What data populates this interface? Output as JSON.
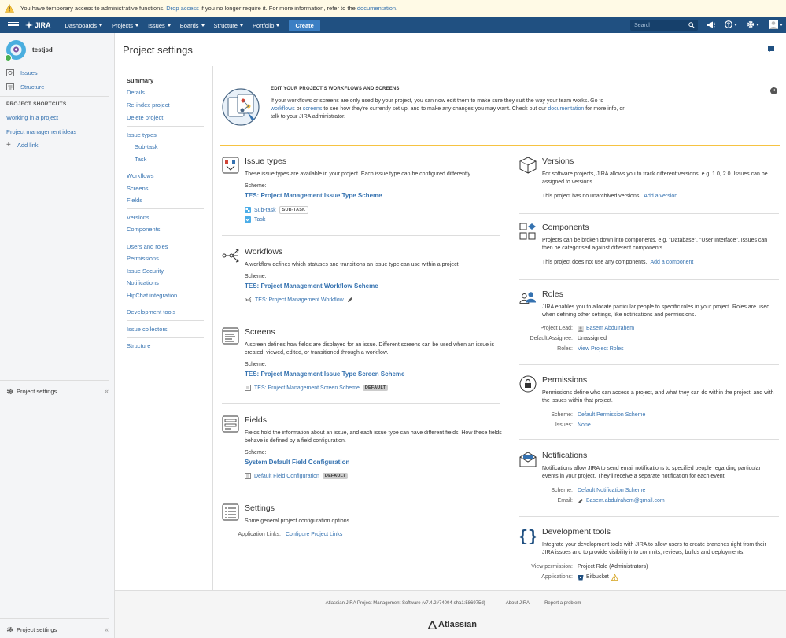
{
  "banner": {
    "prefix": "You have temporary access to administrative functions.",
    "drop_link": "Drop access",
    "middle": "if you no longer require it. For more information, refer to the",
    "docs_link": "documentation",
    "suffix": "."
  },
  "topnav": {
    "logo": "JIRA",
    "menus": [
      "Dashboards",
      "Projects",
      "Issues",
      "Boards",
      "Structure",
      "Portfolio"
    ],
    "create": "Create",
    "search_placeholder": "Search"
  },
  "sidebar": {
    "project_name": "testjsd",
    "nav": [
      "Issues",
      "Structure"
    ],
    "shortcuts_heading": "PROJECT SHORTCUTS",
    "shortcuts": [
      "Working in a project",
      "Project management ideas"
    ],
    "add_link": "Add link",
    "footer_label": "Project settings"
  },
  "page": {
    "title": "Project settings"
  },
  "settings_nav": {
    "summary": "Summary",
    "group1": [
      "Details",
      "Re-index project",
      "Delete project"
    ],
    "issue_types": "Issue types",
    "issue_type_children": [
      "Sub-task",
      "Task"
    ],
    "group3": [
      "Workflows",
      "Screens",
      "Fields"
    ],
    "group4": [
      "Versions",
      "Components"
    ],
    "group5": [
      "Users and roles",
      "Permissions",
      "Issue Security",
      "Notifications",
      "HipChat integration"
    ],
    "group6": [
      "Development tools"
    ],
    "group7": [
      "Issue collectors"
    ],
    "group8": [
      "Structure"
    ]
  },
  "promo": {
    "heading": "EDIT YOUR PROJECT'S WORKFLOWS AND SCREENS",
    "t1": "If your workflows or screens are only used by your project, you can now edit them to make sure they suit the way your team works. Go to",
    "l_workflows": "workflows",
    "t_or": "or",
    "l_screens": "screens",
    "t2": "to see how they're currently set up, and to make any changes you may want. Check out our",
    "l_docs": "documentation",
    "t3": "for more info, or talk to your JIRA administrator."
  },
  "issue_types": {
    "title": "Issue types",
    "desc": "These issue types are available in your project. Each issue type can be configured differently.",
    "scheme_label": "Scheme:",
    "scheme": "TES: Project Management Issue Type Scheme",
    "items": [
      {
        "name": "Sub-task",
        "tag": "SUB-TASK"
      },
      {
        "name": "Task",
        "tag": ""
      }
    ]
  },
  "workflows": {
    "title": "Workflows",
    "desc": "A workflow defines which statuses and transitions an issue type can use within a project.",
    "scheme_label": "Scheme:",
    "scheme": "TES: Project Management Workflow Scheme",
    "item": "TES: Project Management Workflow"
  },
  "screens": {
    "title": "Screens",
    "desc": "A screen defines how fields are displayed for an issue. Different screens can be used when an issue is created, viewed, edited, or transitioned through a workflow.",
    "scheme_label": "Scheme:",
    "scheme": "TES: Project Management Issue Type Screen Scheme",
    "item": "TES: Project Management Screen Scheme",
    "tag": "DEFAULT"
  },
  "fields": {
    "title": "Fields",
    "desc": "Fields hold the information about an issue, and each issue type can have different fields. How these fields behave is defined by a field configuration.",
    "scheme_label": "Scheme:",
    "scheme": "System Default Field Configuration",
    "item": "Default Field Configuration",
    "tag": "DEFAULT"
  },
  "settings": {
    "title": "Settings",
    "desc": "Some general project configuration options.",
    "app_links_label": "Application Links:",
    "app_links": "Configure Project Links"
  },
  "versions": {
    "title": "Versions",
    "desc": "For software projects, JIRA allows you to track different versions, e.g. 1.0, 2.0. Issues can be assigned to versions.",
    "status": "This project has no unarchived versions.",
    "add": "Add a version"
  },
  "components": {
    "title": "Components",
    "desc": "Projects can be broken down into components, e.g. \"Database\", \"User Interface\". Issues can then be categorised against different components.",
    "status": "This project does not use any components.",
    "add": "Add a component"
  },
  "roles": {
    "title": "Roles",
    "desc": "JIRA enables you to allocate particular people to specific roles in your project. Roles are used when defining other settings, like notifications and permissions.",
    "lead_label": "Project Lead:",
    "lead": "Basem Abdulrahem",
    "assignee_label": "Default Assignee:",
    "assignee": "Unassigned",
    "roles_label": "Roles:",
    "roles_link": "View Project Roles"
  },
  "permissions": {
    "title": "Permissions",
    "desc": "Permissions define who can access a project, and what they can do within the project, and with the issues within that project.",
    "scheme_label": "Scheme:",
    "scheme": "Default Permission Scheme",
    "issues_label": "Issues:",
    "issues": "None"
  },
  "notifications": {
    "title": "Notifications",
    "desc": "Notifications allow JIRA to send email notifications to specified people regarding particular events in your project. They'll receive a separate notification for each event.",
    "scheme_label": "Scheme:",
    "scheme": "Default Notification Scheme",
    "email_label": "Email:",
    "email": "Basem.abdulrahem@gmail.com"
  },
  "devtools": {
    "title": "Development tools",
    "desc": "Integrate your development tools with JIRA to allow users to create branches right from their JIRA issues and to provide visibility into commits, reviews, builds and deployments.",
    "view_label": "View permission:",
    "view": "Project Role (Administrators)",
    "apps_label": "Applications:",
    "apps": "Bitbucket"
  },
  "footer": {
    "version": "Atlassian JIRA Project Management Software (v7.4.2#74004-sha1:586975d)",
    "about": "About JIRA",
    "report": "Report a problem",
    "logo": "Atlassian"
  }
}
